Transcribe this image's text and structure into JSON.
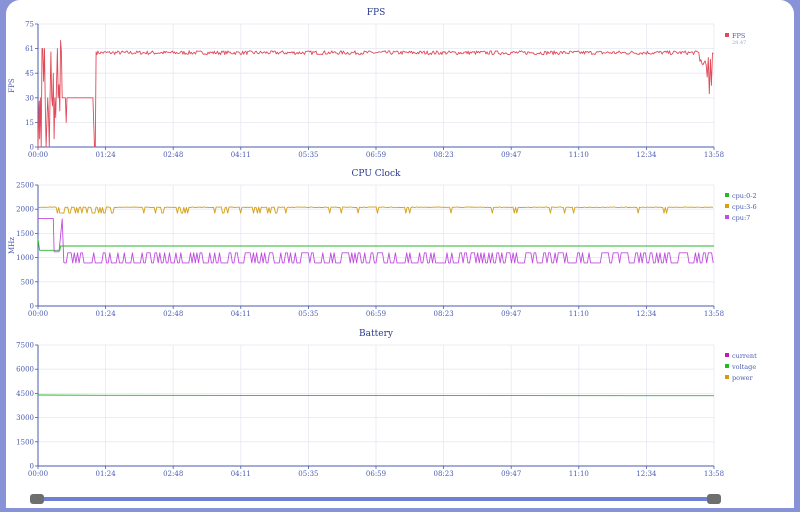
{
  "colors": {
    "fps": "#e04a5a",
    "cpu02": "#2bb52b",
    "cpu36": "#d4a017",
    "cpu7": "#c04ddf",
    "current": "#c01eb0",
    "voltage": "#22bb22",
    "power": "#d49a10",
    "axis": "#4a5bb0",
    "grid": "#e6e8f2"
  },
  "chart_data": [
    {
      "type": "line",
      "title": "FPS",
      "ylabel": "FPS",
      "xlabel": "",
      "ylim": [
        0,
        75
      ],
      "yticks": [
        "0",
        "15",
        "30",
        "45",
        "61",
        "75"
      ],
      "xticks": [
        "00:00",
        "01:24",
        "02:48",
        "04:11",
        "05:35",
        "06:59",
        "08:23",
        "09:47",
        "11:10",
        "12:34",
        "13:58"
      ],
      "x_range_seconds": [
        0,
        838
      ],
      "legend": "top-right",
      "series": [
        {
          "name": "FPS",
          "legend_value": "28.47",
          "approx": "0-70s erratic 0-65 (spikes ~60-65, plateau ~30 from 30-68s), from ~72s steady ~58 with jitter, dip to ~25 near 835s"
        }
      ]
    },
    {
      "type": "line",
      "title": "CPU Clock",
      "ylabel": "MHz",
      "xlabel": "",
      "ylim": [
        0,
        2500
      ],
      "yticks": [
        "0",
        "500",
        "1000",
        "1500",
        "2000",
        "2500"
      ],
      "xticks": [
        "00:00",
        "01:24",
        "02:48",
        "04:11",
        "05:35",
        "06:59",
        "08:23",
        "09:47",
        "11:10",
        "12:34",
        "13:58"
      ],
      "x_range_seconds": [
        0,
        838
      ],
      "legend": "top-right",
      "series": [
        {
          "name": "cpu:0-2",
          "approx": "~1400 at start, ~1150 until ~50s, then ~1240 flat"
        },
        {
          "name": "cpu:3-6",
          "approx": "~2050 with frequent dips to ~1920"
        },
        {
          "name": "cpu:7",
          "approx": "~1800 until ~20s, then oscillating between ~900 and ~1100"
        }
      ]
    },
    {
      "type": "line",
      "title": "Battery",
      "ylabel": "",
      "xlabel": "",
      "ylim": [
        0,
        7500
      ],
      "yticks": [
        "0",
        "1500",
        "3000",
        "4500",
        "6000",
        "7500"
      ],
      "xticks": [
        "00:00",
        "01:24",
        "02:48",
        "04:11",
        "05:35",
        "06:59",
        "08:23",
        "09:47",
        "11:10",
        "12:34",
        "13:58"
      ],
      "x_range_seconds": [
        0,
        838
      ],
      "legend": "top-right",
      "series": [
        {
          "name": "current",
          "values": []
        },
        {
          "name": "voltage",
          "x": [
            0,
            80,
            838
          ],
          "values": [
            4400,
            4380,
            4360
          ]
        },
        {
          "name": "power",
          "values": []
        }
      ]
    }
  ],
  "slider": {
    "start": 0,
    "end": 1
  }
}
